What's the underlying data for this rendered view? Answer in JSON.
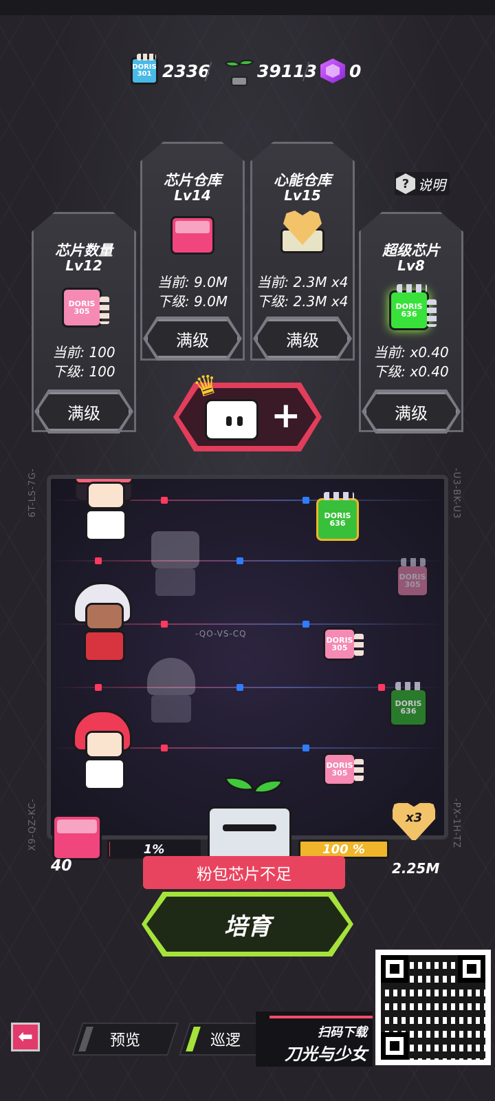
{
  "resources": {
    "chip_icon_label": "DORIS 301",
    "chip_count": "2336",
    "sprout_count": "39113",
    "gem_count": "0"
  },
  "help": {
    "label": "说明"
  },
  "cards": [
    {
      "title": "芯片数量",
      "level": "Lv12",
      "icon_label": "DORIS 305",
      "current": "当前: 100",
      "next": "下级: 100",
      "button": "满级",
      "icon_color": "#f58ab4"
    },
    {
      "title": "芯片仓库",
      "level": "Lv14",
      "current": "当前: 9.0M",
      "next": "下级: 9.0M",
      "button": "满级",
      "icon_color": "#f0457d"
    },
    {
      "title": "心能仓库",
      "level": "Lv15",
      "current": "当前: 2.3M x4",
      "next": "下级: 2.3M x4",
      "button": "满级",
      "icon_color": "#f3c36a"
    },
    {
      "title": "超级芯片",
      "level": "Lv8",
      "icon_label": "DORIS 636",
      "current": "当前: x0.40",
      "next": "下级: x0.40",
      "button": "满级",
      "icon_color": "#39e23a"
    }
  ],
  "arena": {
    "side_codes": {
      "left_top": "6T-LS-7G-",
      "right_top": "-U3-BK-U3",
      "left_bottom": "X9-QZ-KC-",
      "right_bottom": "-PX-1H-TZ",
      "center": "-QO-VS-CQ"
    },
    "chips": [
      {
        "label": "DORIS 636",
        "color": "#39c03a"
      },
      {
        "label": "DORIS 305",
        "color": "#f58ab4"
      },
      {
        "label": "DORIS 305",
        "color": "#f58ab4"
      },
      {
        "label": "DORIS 636",
        "color": "#2d9a2c"
      },
      {
        "label": "DORIS 305",
        "color": "#f58ab4"
      }
    ]
  },
  "progress": {
    "left_value": "40",
    "left_bar_text": "1%",
    "left_fill": 0.01,
    "right_bar_text": "100 %",
    "right_fill": 1.0,
    "multiplier": "x3",
    "right_value": "2.25M"
  },
  "warning": {
    "text": "粉包芯片不足"
  },
  "grow_button": {
    "label": "培育"
  },
  "nav": {
    "preview": "预览",
    "patrol": "巡逻",
    "back_icon": "arrow-left"
  },
  "promo": {
    "line1": "扫码下载",
    "line2": "刀光与少女"
  },
  "colors": {
    "accent_pink": "#e23d5b",
    "accent_green": "#a6e33a",
    "gold": "#f0b52a"
  }
}
